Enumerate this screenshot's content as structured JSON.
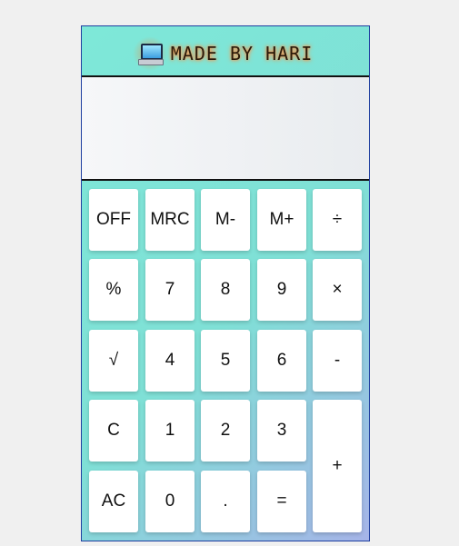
{
  "header": {
    "title": "MADE BY HARI",
    "icon": "computer-icon"
  },
  "display": {
    "value": ""
  },
  "keys": {
    "off": "OFF",
    "mrc": "MRC",
    "m_minus": "M-",
    "m_plus": "M+",
    "divide": "÷",
    "percent": "%",
    "seven": "7",
    "eight": "8",
    "nine": "9",
    "multiply": "×",
    "sqrt": "√",
    "four": "4",
    "five": "5",
    "six": "6",
    "minus": "-",
    "clear": "C",
    "one": "1",
    "two": "2",
    "three": "3",
    "plus": "+",
    "all_clear": "AC",
    "zero": "0",
    "decimal": ".",
    "equals": "="
  },
  "colors": {
    "border": "#1f3fa0",
    "gradient_start": "#7ee8d8",
    "gradient_end": "#a6b4e8",
    "title_glow": "#ff8a3a"
  }
}
